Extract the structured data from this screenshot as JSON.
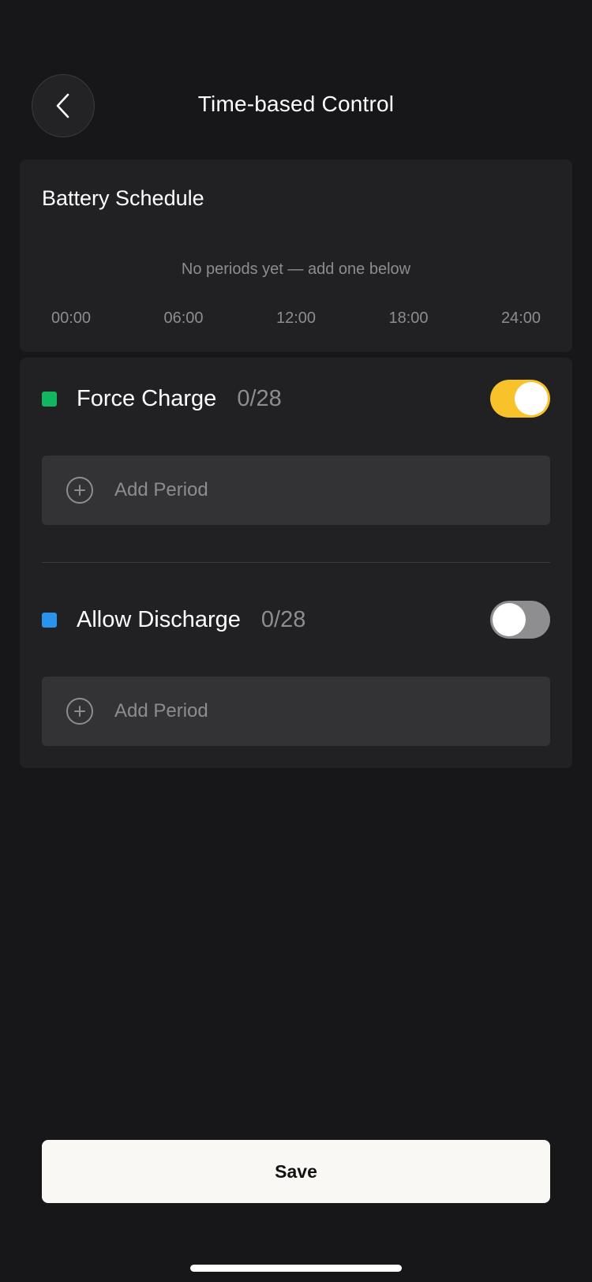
{
  "header": {
    "title": "Time-based Control",
    "back_icon": "chevron-left-icon"
  },
  "schedule": {
    "title": "Battery Schedule",
    "empty_text": "No periods yet — add one below",
    "timeline_labels": [
      "00:00",
      "06:00",
      "12:00",
      "18:00",
      "24:00"
    ]
  },
  "modes": [
    {
      "label": "Force Charge",
      "count": "0/28",
      "color": "#12b560",
      "enabled": true,
      "add_label": "Add Period",
      "add_icon": "plus-circle-icon"
    },
    {
      "label": "Allow Discharge",
      "count": "0/28",
      "color": "#2a93eb",
      "enabled": false,
      "add_label": "Add Period",
      "add_icon": "plus-circle-icon"
    }
  ],
  "colors": {
    "background": "#171719",
    "card": "#212123",
    "toggle_on": "#f8c22a",
    "toggle_off": "#8e8e90"
  },
  "save_label": "Save"
}
